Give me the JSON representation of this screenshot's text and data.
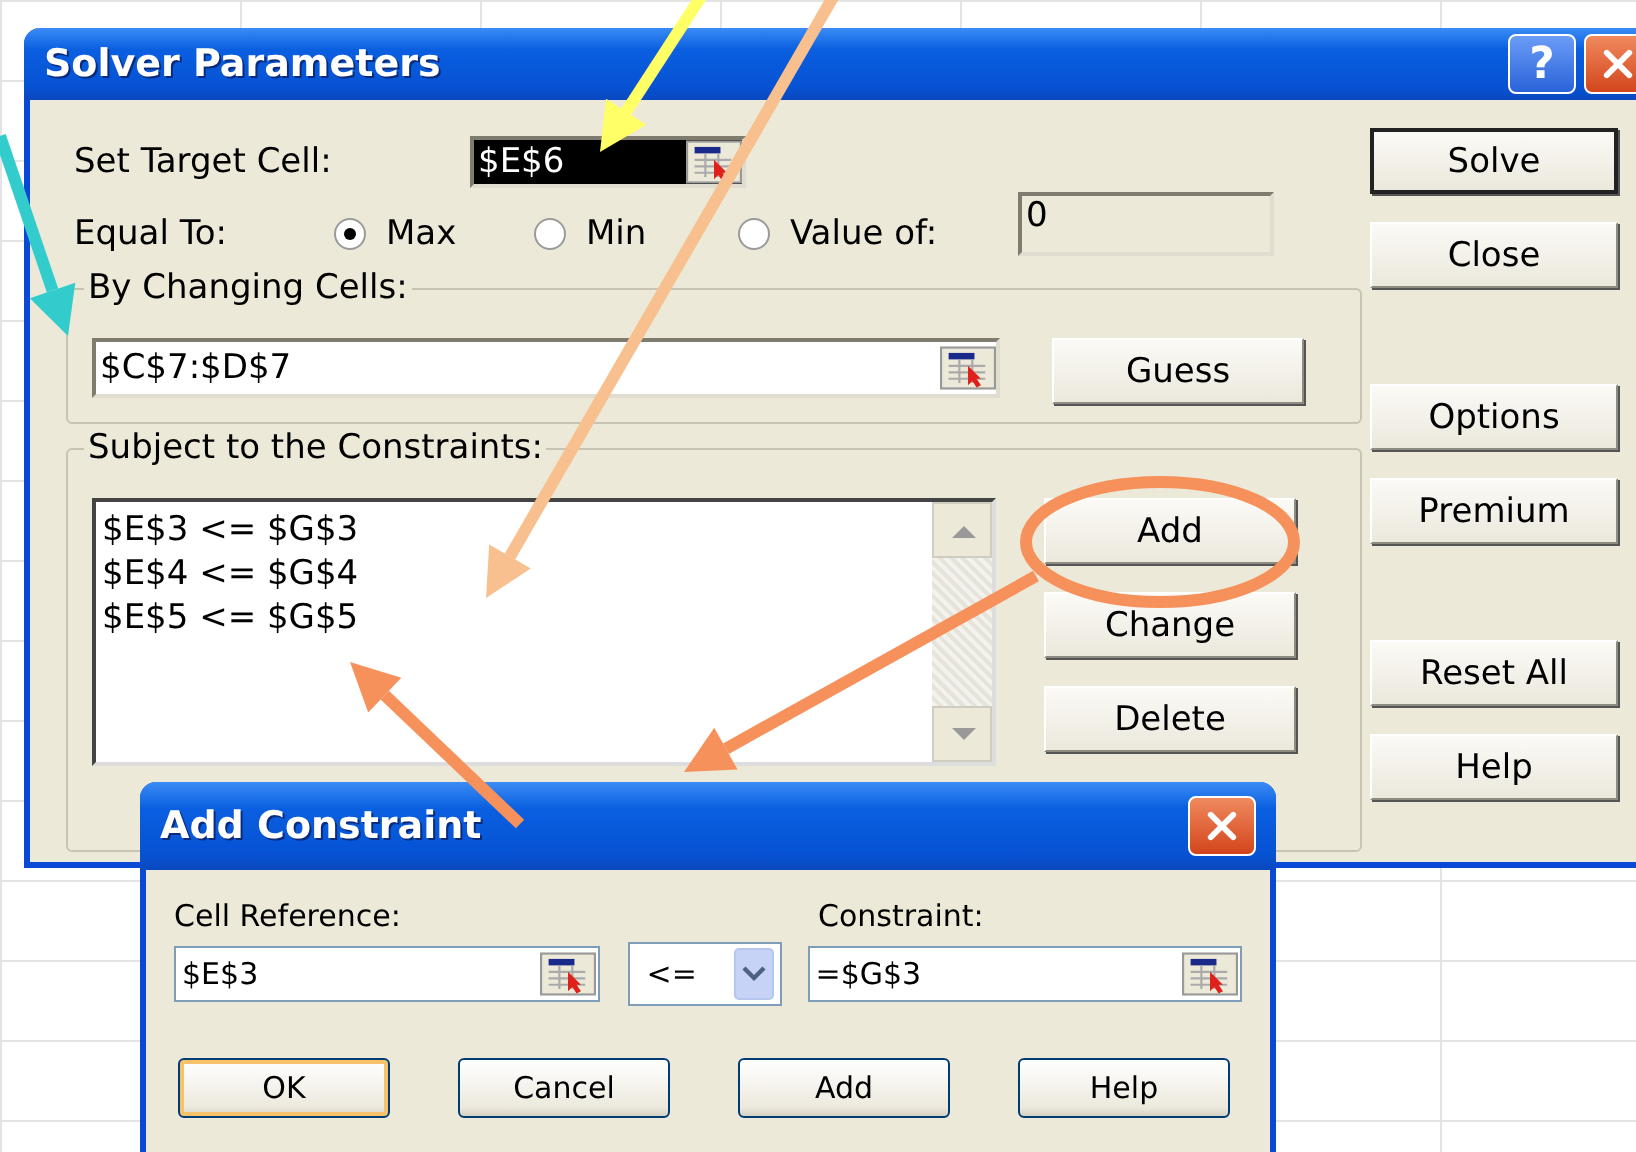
{
  "solver_dialog": {
    "title": "Solver Parameters",
    "help_button": "?",
    "set_target_cell": {
      "label": "Set Target Cell:",
      "value": "$E$6",
      "highlighted": true
    },
    "equal_to": {
      "label": "Equal To:",
      "options": [
        {
          "label": "Max",
          "selected": true
        },
        {
          "label": "Min",
          "selected": false
        },
        {
          "label": "Value of:",
          "selected": false
        }
      ],
      "value_field": {
        "value": "0",
        "disabled": true
      }
    },
    "changing_cells": {
      "label": "By Changing Cells:",
      "value": "$C$7:$D$7",
      "button": "Guess"
    },
    "constraints": {
      "label": "Subject to the Constraints:",
      "items": [
        "$E$3 <= $G$3",
        "$E$4 <= $G$4",
        "$E$5 <= $G$5"
      ],
      "buttons": [
        "Add",
        "Change",
        "Delete"
      ]
    },
    "side_buttons": [
      {
        "label": "Solve",
        "default": true
      },
      {
        "label": "Close",
        "default": false
      },
      {
        "label": "Options",
        "default": false
      },
      {
        "label": "Premium",
        "default": false
      },
      {
        "label": "Reset All",
        "default": false
      },
      {
        "label": "Help",
        "default": false
      }
    ]
  },
  "add_constraint_dialog": {
    "title": "Add Constraint",
    "cell_reference": {
      "label": "Cell Reference:",
      "value": "$E$3"
    },
    "operator": "<=",
    "constraint": {
      "label": "Constraint:",
      "value": "=$G$3"
    },
    "buttons": [
      {
        "label": "OK",
        "default": true
      },
      {
        "label": "Cancel",
        "default": false
      },
      {
        "label": "Add",
        "default": false
      },
      {
        "label": "Help",
        "default": false
      }
    ]
  },
  "annotations": [
    {
      "kind": "arrow",
      "color": "#ffff66"
    },
    {
      "kind": "arrow",
      "color": "#f7c08e"
    },
    {
      "kind": "arrow",
      "color": "#33cccc"
    },
    {
      "kind": "ellipse",
      "color": "#f7915c"
    },
    {
      "kind": "arrow",
      "color": "#f7915c"
    },
    {
      "kind": "arrow",
      "color": "#f7915c"
    }
  ]
}
